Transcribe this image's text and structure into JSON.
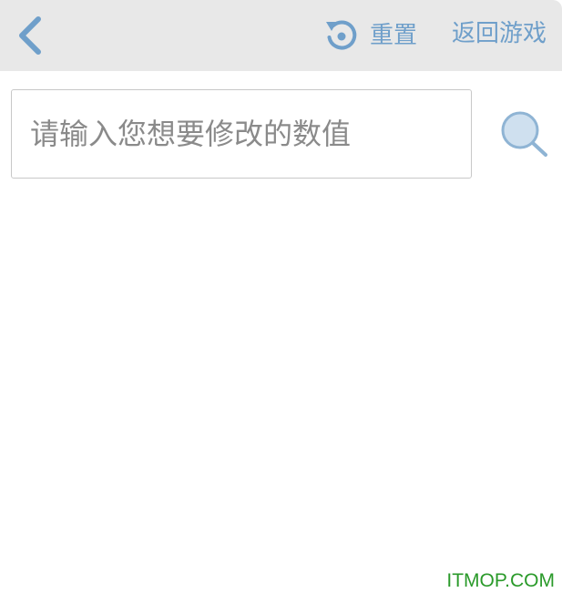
{
  "header": {
    "back_icon": "chevron-left-icon",
    "reset_icon": "refresh-icon",
    "reset_label": "重置",
    "return_label": "返回游戏"
  },
  "search": {
    "placeholder": "请输入您想要修改的数值",
    "value": "",
    "button_icon": "search-icon"
  },
  "watermark": {
    "text": "ITMOP.COM"
  },
  "colors": {
    "accent": "#6f9fca",
    "header_bg": "#e8e8e8",
    "watermark": "#2a9a2a"
  }
}
